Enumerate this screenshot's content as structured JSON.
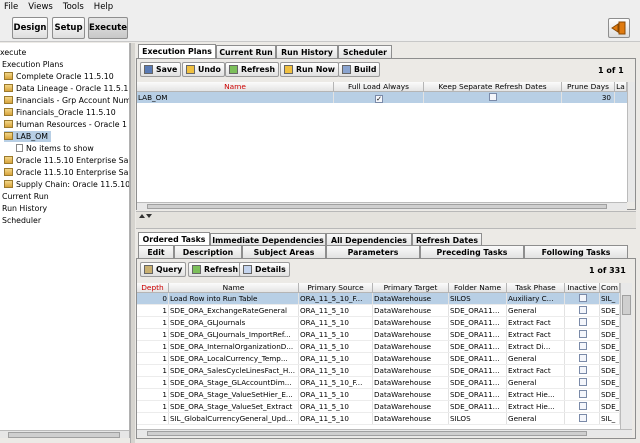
{
  "menu": [
    "File",
    "Views",
    "Tools",
    "Help"
  ],
  "toolbar": {
    "design": "Design",
    "setup": "Setup",
    "execute": "Execute"
  },
  "tree": {
    "root": "xecute",
    "plans_node": "Execution Plans",
    "plans": [
      "Complete Oracle 11.5.10",
      "Data Lineage - Oracle 11.5.1",
      "Financials - Grp Account Num",
      "Financials_Oracle 11.5.10",
      "Human Resources - Oracle 1",
      "LAB_OM"
    ],
    "no_items": "No items to show",
    "plans2": [
      "Oracle 11.5.10 Enterprise Sa",
      "Oracle 11.5.10 Enterprise Sa",
      "Supply Chain: Oracle 11.5.10"
    ],
    "others": [
      "Current Run",
      "Run History",
      "Scheduler"
    ]
  },
  "top": {
    "tabs": [
      "Execution Plans",
      "Current Run",
      "Run History",
      "Scheduler"
    ],
    "buttons": {
      "save": "Save",
      "undo": "Undo",
      "refresh": "Refresh",
      "run_now": "Run Now",
      "build": "Build"
    },
    "pager": "1 of 1",
    "columns": {
      "name": "Name",
      "full_load": "Full Load Always",
      "separate": "Keep Separate Refresh Dates",
      "prune": "Prune Days",
      "last": "La"
    },
    "row": {
      "name": "LAB_OM",
      "full_load": true,
      "separate": false,
      "prune": "30"
    }
  },
  "bottom": {
    "tabs_row1": [
      "Ordered Tasks",
      "Immediate Dependencies",
      "All Dependencies",
      "Refresh Dates"
    ],
    "tabs_row2": [
      "Edit",
      "Description",
      "Subject Areas",
      "Parameters",
      "Preceding Tasks",
      "Following Tasks"
    ],
    "buttons": {
      "query": "Query",
      "refresh": "Refresh",
      "details": "Details"
    },
    "pager": "1 of 331",
    "columns": {
      "depth": "Depth",
      "name": "Name",
      "src": "Primary Source",
      "tgt": "Primary Target",
      "folder": "Folder Name",
      "phase": "Task Phase",
      "inactive": "Inactive",
      "com": "Com"
    },
    "rows": [
      {
        "depth": "0",
        "name": "Load Row into Run Table",
        "src": "ORA_11_5_10_F...",
        "tgt": "DataWarehouse",
        "folder": "SILOS",
        "phase": "Auxiliary C...",
        "com": "SIL_"
      },
      {
        "depth": "1",
        "name": "SDE_ORA_ExchangeRateGeneral",
        "src": "ORA_11_5_10",
        "tgt": "DataWarehouse",
        "folder": "SDE_ORA11...",
        "phase": "General",
        "com": "SDE_"
      },
      {
        "depth": "1",
        "name": "SDE_ORA_GLJournals",
        "src": "ORA_11_5_10",
        "tgt": "DataWarehouse",
        "folder": "SDE_ORA11...",
        "phase": "Extract Fact",
        "com": "SDE_"
      },
      {
        "depth": "1",
        "name": "SDE_ORA_GLJournals_ImportRef...",
        "src": "ORA_11_5_10",
        "tgt": "DataWarehouse",
        "folder": "SDE_ORA11...",
        "phase": "Extract Fact",
        "com": "SDE_"
      },
      {
        "depth": "1",
        "name": "SDE_ORA_InternalOrganizationD...",
        "src": "ORA_11_5_10",
        "tgt": "DataWarehouse",
        "folder": "SDE_ORA11...",
        "phase": "Extract Di...",
        "com": "SDE_"
      },
      {
        "depth": "1",
        "name": "SDE_ORA_LocalCurrency_Temp...",
        "src": "ORA_11_5_10",
        "tgt": "DataWarehouse",
        "folder": "SDE_ORA11...",
        "phase": "General",
        "com": "SDE_"
      },
      {
        "depth": "1",
        "name": "SDE_ORA_SalesCycleLinesFact_H...",
        "src": "ORA_11_5_10",
        "tgt": "DataWarehouse",
        "folder": "SDE_ORA11...",
        "phase": "Extract Fact",
        "com": "SDE_"
      },
      {
        "depth": "1",
        "name": "SDE_ORA_Stage_GLAccountDim...",
        "src": "ORA_11_5_10_F...",
        "tgt": "DataWarehouse",
        "folder": "SDE_ORA11...",
        "phase": "General",
        "com": "SDE_"
      },
      {
        "depth": "1",
        "name": "SDE_ORA_Stage_ValueSetHier_E...",
        "src": "ORA_11_5_10",
        "tgt": "DataWarehouse",
        "folder": "SDE_ORA11...",
        "phase": "Extract Hie...",
        "com": "SDE_"
      },
      {
        "depth": "1",
        "name": "SDE_ORA_Stage_ValueSet_Extract",
        "src": "ORA_11_5_10",
        "tgt": "DataWarehouse",
        "folder": "SDE_ORA11...",
        "phase": "Extract Hie...",
        "com": "SDE_"
      },
      {
        "depth": "1",
        "name": "SIL_GlobalCurrencyGeneral_Upd...",
        "src": "ORA_11_5_10",
        "tgt": "DataWarehouse",
        "folder": "SILOS",
        "phase": "General",
        "com": "SIL_"
      }
    ]
  },
  "colors": {
    "selection": "#b8cfe5",
    "accent": "#e07b10",
    "header_red": "#cc0000"
  }
}
